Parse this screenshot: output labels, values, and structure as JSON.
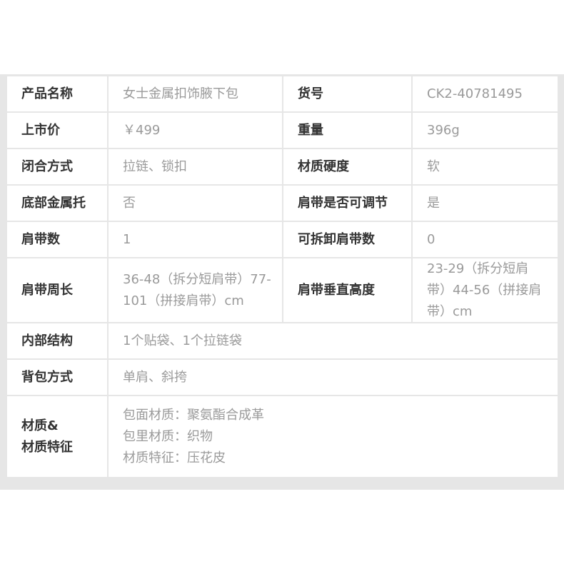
{
  "rows": [
    {
      "label": "产品名称",
      "value": "女士金属扣饰腋下包",
      "label2": "货号",
      "value2": "CK2-40781495"
    },
    {
      "label": "上市价",
      "value": "￥499",
      "label2": "重量",
      "value2": "396g"
    },
    {
      "label": "闭合方式",
      "value": "拉链、锁扣",
      "label2": "材质硬度",
      "value2": "软"
    },
    {
      "label": "底部金属托",
      "value": "否",
      "label2": "肩带是否可调节",
      "value2": "是"
    },
    {
      "label": "肩带数",
      "value": "1",
      "label2": "可拆卸肩带数",
      "value2": "0"
    },
    {
      "label": "肩带周长",
      "value": "36-48（拆分短肩带）77-\n101（拼接肩带）cm",
      "label2": "肩带垂直高度",
      "value2": "23-29（拆分短肩\n带）44-56（拼接肩\n带）cm"
    }
  ],
  "full_rows": [
    {
      "label": "内部结构",
      "value": "1个贴袋、1个拉链袋"
    },
    {
      "label": "背包方式",
      "value": "单肩、斜挎"
    },
    {
      "label": "材质&\n材质特征",
      "value": "包面材质：聚氨酯合成革\n包里材质：织物\n材质特征：压花皮"
    }
  ]
}
